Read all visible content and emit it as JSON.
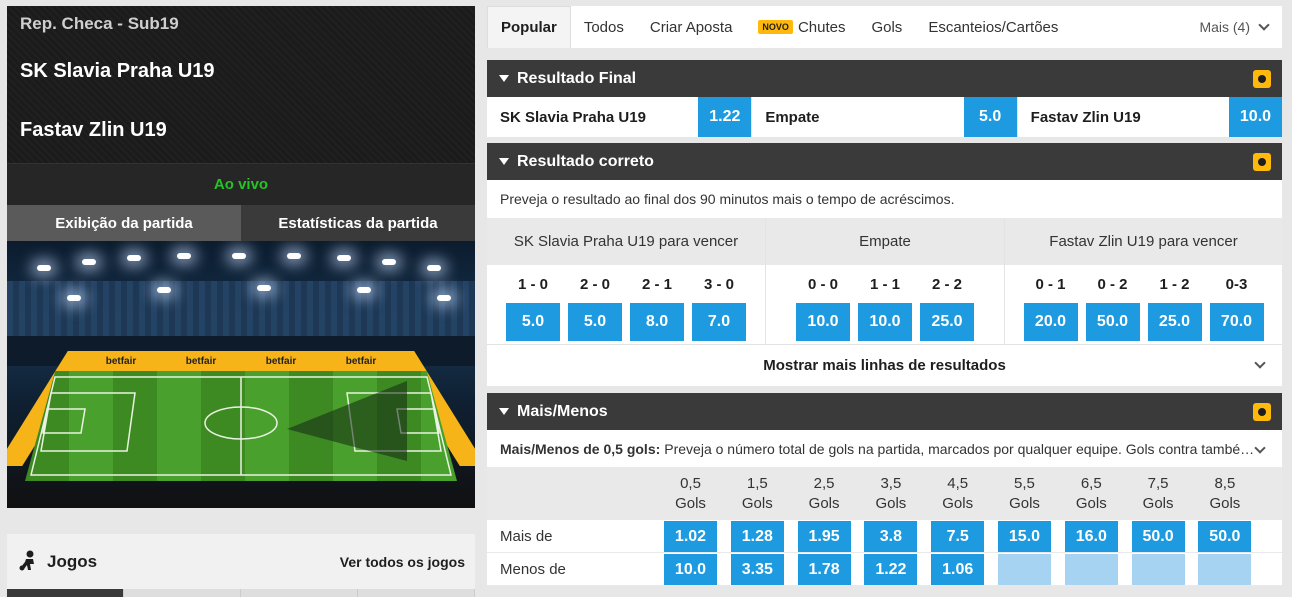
{
  "match": {
    "competition": "Rep. Checa - Sub19",
    "home": "SK Slavia Praha U19",
    "away": "Fastav Zlin U19",
    "status": "Ao vivo",
    "view_tabs": [
      "Exibição da partida",
      "Estatísticas da partida"
    ],
    "ad_brand": "betfair"
  },
  "games": {
    "title": "Jogos",
    "link": "Ver todos os jogos"
  },
  "market_tabs": {
    "items": [
      "Popular",
      "Todos",
      "Criar Aposta",
      "Chutes",
      "Gols",
      "Escanteios/Cartões"
    ],
    "new_badge": "NOVO",
    "more": "Mais (4)"
  },
  "match_odds": {
    "title": "Resultado Final",
    "selections": [
      {
        "name": "SK Slavia Praha U19",
        "odd": "1.22"
      },
      {
        "name": "Empate",
        "odd": "5.0"
      },
      {
        "name": "Fastav Zlin U19",
        "odd": "10.0"
      }
    ]
  },
  "correct_score": {
    "title": "Resultado correto",
    "description": "Preveja o resultado ao final dos 90 minutos mais o tempo de acréscimos.",
    "groups": [
      {
        "header": "SK Slavia Praha U19 para vencer",
        "cells": [
          {
            "score": "1 - 0",
            "odd": "5.0"
          },
          {
            "score": "2 - 0",
            "odd": "5.0"
          },
          {
            "score": "2 - 1",
            "odd": "8.0"
          },
          {
            "score": "3 - 0",
            "odd": "7.0"
          }
        ]
      },
      {
        "header": "Empate",
        "cells": [
          {
            "score": "0 - 0",
            "odd": "10.0"
          },
          {
            "score": "1 - 1",
            "odd": "10.0"
          },
          {
            "score": "2 - 2",
            "odd": "25.0"
          }
        ]
      },
      {
        "header": "Fastav Zlin U19 para vencer",
        "cells": [
          {
            "score": "0 - 1",
            "odd": "20.0"
          },
          {
            "score": "0 - 2",
            "odd": "50.0"
          },
          {
            "score": "1 - 2",
            "odd": "25.0"
          },
          {
            "score": "0-3",
            "odd": "70.0"
          }
        ]
      }
    ],
    "more_lines": "Mostrar mais linhas de resultados"
  },
  "over_under": {
    "title": "Mais/Menos",
    "desc_label": "Mais/Menos de 0,5 gols:",
    "desc_text": "Preveja o número total de gols na partida, marcados por qualquer equipe. Gols contra també…",
    "lines": [
      {
        "line": "0,5",
        "unit": "Gols"
      },
      {
        "line": "1,5",
        "unit": "Gols"
      },
      {
        "line": "2,5",
        "unit": "Gols"
      },
      {
        "line": "3,5",
        "unit": "Gols"
      },
      {
        "line": "4,5",
        "unit": "Gols"
      },
      {
        "line": "5,5",
        "unit": "Gols"
      },
      {
        "line": "6,5",
        "unit": "Gols"
      },
      {
        "line": "7,5",
        "unit": "Gols"
      },
      {
        "line": "8,5",
        "unit": "Gols"
      }
    ],
    "rows": [
      {
        "label": "Mais de",
        "odds": [
          "1.02",
          "1.28",
          "1.95",
          "3.8",
          "7.5",
          "15.0",
          "16.0",
          "50.0",
          "50.0"
        ]
      },
      {
        "label": "Menos de",
        "odds": [
          "10.0",
          "3.35",
          "1.78",
          "1.22",
          "1.06",
          "",
          "",
          "",
          ""
        ]
      }
    ]
  },
  "colors": {
    "odds_blue": "#1d9ae0",
    "live_green": "#22c522",
    "accent_yellow": "#ffb80c",
    "header_dark": "#3a3a3a"
  }
}
